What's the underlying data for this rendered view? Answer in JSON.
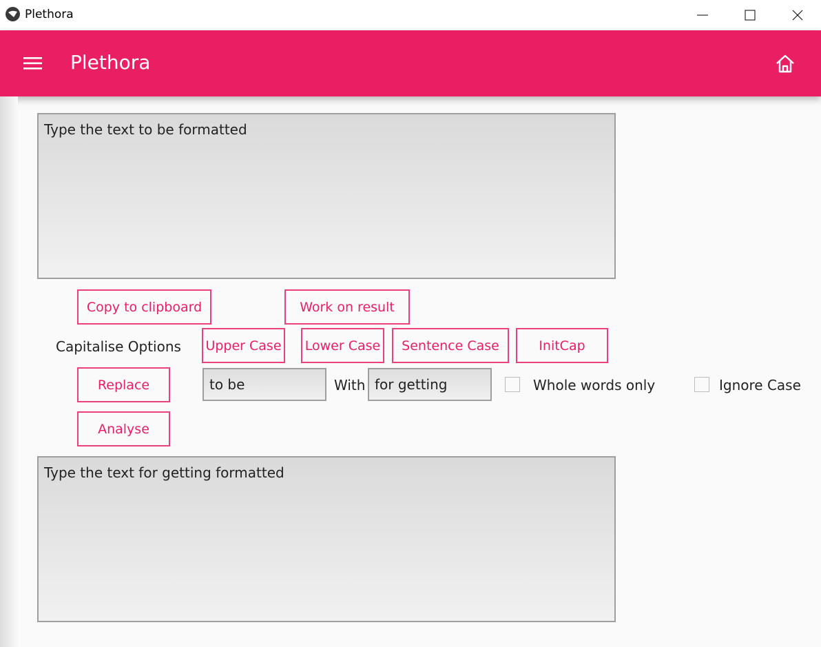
{
  "window": {
    "title": "Plethora"
  },
  "appbar": {
    "title": "Plethora"
  },
  "input_area": {
    "text": "Type the text to be formatted"
  },
  "buttons": {
    "copy": "Copy to clipboard",
    "work_on_result": "Work on result",
    "upper_case": "Upper Case",
    "lower_case": "Lower Case",
    "sentence_case": "Sentence Case",
    "initcap": "InitCap",
    "replace": "Replace",
    "analyse": "Analyse"
  },
  "capitalise_label": "Capitalise Options",
  "replace": {
    "find_value": "to be",
    "with_label": "With",
    "replace_value": "for getting",
    "whole_words_label": "Whole words only",
    "ignore_case_label": "Ignore Case"
  },
  "output_area": {
    "text": "Type the text for getting formatted"
  },
  "colors": {
    "accent": "#e91e63",
    "button_border": "#ec407a"
  },
  "icons": [
    "app-icon",
    "minimize-icon",
    "maximize-icon",
    "close-icon",
    "menu-icon",
    "home-icon"
  ]
}
